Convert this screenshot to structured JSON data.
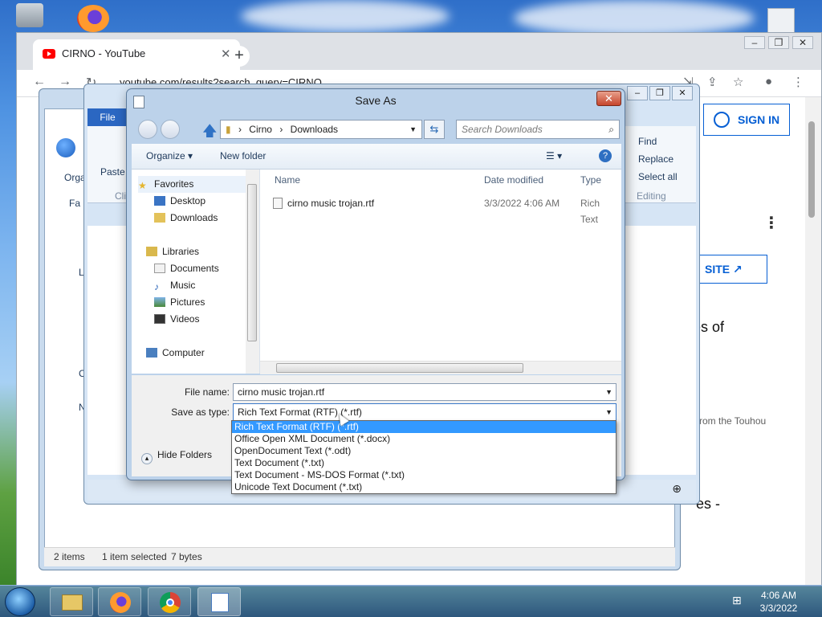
{
  "chrome": {
    "tab_title": "CIRNO - YouTube",
    "url": "youtube.com/results?search_query=CIRNO",
    "sign_in_label": "SIGN IN",
    "visit_site_label": "SITE",
    "partial_text_1": "ies of",
    "partial_text_2": "rom the Touhou",
    "partial_text_3": "es -"
  },
  "explorer": {
    "organize_label": "Organ",
    "left_items": [
      "Fa",
      "Li",
      "C",
      "N"
    ],
    "status_items": "2 items",
    "status_selected": "1 item selected",
    "status_size": "7 bytes"
  },
  "wordpad": {
    "file_tab": "File",
    "paste_label": "Paste",
    "clip_label": "Clip",
    "find_label": "Find",
    "replace_label": "Replace",
    "select_all_label": "Select all",
    "editing_label": "Editing"
  },
  "dialog": {
    "title": "Save As",
    "breadcrumb": [
      "Cirno",
      "Downloads"
    ],
    "search_placeholder": "Search Downloads",
    "organize_label": "Organize",
    "new_folder_label": "New folder",
    "nav": {
      "favorites": "Favorites",
      "desktop": "Desktop",
      "downloads": "Downloads",
      "libraries": "Libraries",
      "documents": "Documents",
      "music": "Music",
      "pictures": "Pictures",
      "videos": "Videos",
      "computer": "Computer"
    },
    "columns": {
      "name": "Name",
      "date": "Date modified",
      "type": "Type"
    },
    "files": [
      {
        "name": "cirno music trojan.rtf",
        "date": "3/3/2022 4:06 AM",
        "type": "Rich Text"
      }
    ],
    "file_name_label": "File name:",
    "file_name_value": "cirno music trojan.rtf",
    "save_type_label": "Save as type:",
    "save_type_value": "Rich Text Format (RTF) (*.rtf)",
    "hide_folders_label": "Hide Folders",
    "type_options": [
      "Rich Text Format (RTF) (*.rtf)",
      "Office Open XML Document (*.docx)",
      "OpenDocument Text (*.odt)",
      "Text Document (*.txt)",
      "Text Document - MS-DOS Format (*.txt)",
      "Unicode Text Document (*.txt)"
    ]
  },
  "taskbar": {
    "time": "4:06 AM",
    "date": "3/3/2022"
  },
  "colors": {
    "accent": "#3399ff",
    "youtube_blue": "#065fd4"
  }
}
